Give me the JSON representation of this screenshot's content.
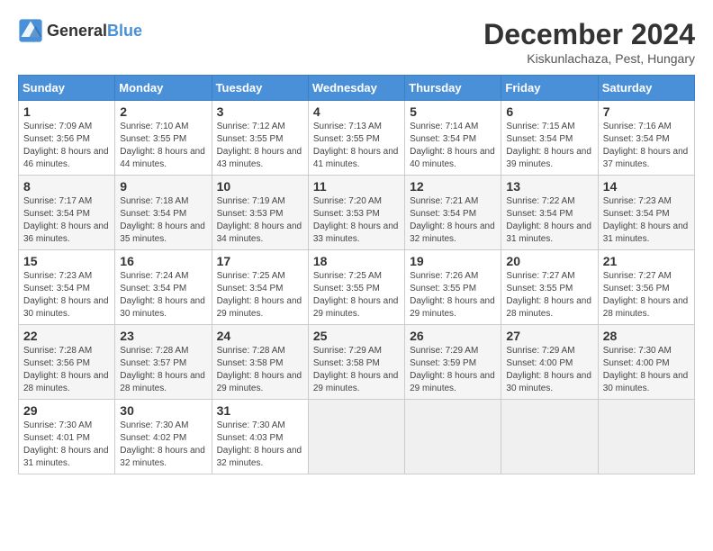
{
  "header": {
    "logo_general": "General",
    "logo_blue": "Blue",
    "title": "December 2024",
    "subtitle": "Kiskunlachaza, Pest, Hungary"
  },
  "calendar": {
    "days_of_week": [
      "Sunday",
      "Monday",
      "Tuesday",
      "Wednesday",
      "Thursday",
      "Friday",
      "Saturday"
    ],
    "weeks": [
      [
        null,
        null,
        null,
        null,
        null,
        null,
        null
      ]
    ]
  },
  "days": [
    {
      "date": "1",
      "sunrise": "7:09 AM",
      "sunset": "3:56 PM",
      "daylight": "8 hours and 46 minutes."
    },
    {
      "date": "2",
      "sunrise": "7:10 AM",
      "sunset": "3:55 PM",
      "daylight": "8 hours and 44 minutes."
    },
    {
      "date": "3",
      "sunrise": "7:12 AM",
      "sunset": "3:55 PM",
      "daylight": "8 hours and 43 minutes."
    },
    {
      "date": "4",
      "sunrise": "7:13 AM",
      "sunset": "3:55 PM",
      "daylight": "8 hours and 41 minutes."
    },
    {
      "date": "5",
      "sunrise": "7:14 AM",
      "sunset": "3:54 PM",
      "daylight": "8 hours and 40 minutes."
    },
    {
      "date": "6",
      "sunrise": "7:15 AM",
      "sunset": "3:54 PM",
      "daylight": "8 hours and 39 minutes."
    },
    {
      "date": "7",
      "sunrise": "7:16 AM",
      "sunset": "3:54 PM",
      "daylight": "8 hours and 37 minutes."
    },
    {
      "date": "8",
      "sunrise": "7:17 AM",
      "sunset": "3:54 PM",
      "daylight": "8 hours and 36 minutes."
    },
    {
      "date": "9",
      "sunrise": "7:18 AM",
      "sunset": "3:54 PM",
      "daylight": "8 hours and 35 minutes."
    },
    {
      "date": "10",
      "sunrise": "7:19 AM",
      "sunset": "3:53 PM",
      "daylight": "8 hours and 34 minutes."
    },
    {
      "date": "11",
      "sunrise": "7:20 AM",
      "sunset": "3:53 PM",
      "daylight": "8 hours and 33 minutes."
    },
    {
      "date": "12",
      "sunrise": "7:21 AM",
      "sunset": "3:54 PM",
      "daylight": "8 hours and 32 minutes."
    },
    {
      "date": "13",
      "sunrise": "7:22 AM",
      "sunset": "3:54 PM",
      "daylight": "8 hours and 31 minutes."
    },
    {
      "date": "14",
      "sunrise": "7:23 AM",
      "sunset": "3:54 PM",
      "daylight": "8 hours and 31 minutes."
    },
    {
      "date": "15",
      "sunrise": "7:23 AM",
      "sunset": "3:54 PM",
      "daylight": "8 hours and 30 minutes."
    },
    {
      "date": "16",
      "sunrise": "7:24 AM",
      "sunset": "3:54 PM",
      "daylight": "8 hours and 30 minutes."
    },
    {
      "date": "17",
      "sunrise": "7:25 AM",
      "sunset": "3:54 PM",
      "daylight": "8 hours and 29 minutes."
    },
    {
      "date": "18",
      "sunrise": "7:25 AM",
      "sunset": "3:55 PM",
      "daylight": "8 hours and 29 minutes."
    },
    {
      "date": "19",
      "sunrise": "7:26 AM",
      "sunset": "3:55 PM",
      "daylight": "8 hours and 29 minutes."
    },
    {
      "date": "20",
      "sunrise": "7:27 AM",
      "sunset": "3:55 PM",
      "daylight": "8 hours and 28 minutes."
    },
    {
      "date": "21",
      "sunrise": "7:27 AM",
      "sunset": "3:56 PM",
      "daylight": "8 hours and 28 minutes."
    },
    {
      "date": "22",
      "sunrise": "7:28 AM",
      "sunset": "3:56 PM",
      "daylight": "8 hours and 28 minutes."
    },
    {
      "date": "23",
      "sunrise": "7:28 AM",
      "sunset": "3:57 PM",
      "daylight": "8 hours and 28 minutes."
    },
    {
      "date": "24",
      "sunrise": "7:28 AM",
      "sunset": "3:58 PM",
      "daylight": "8 hours and 29 minutes."
    },
    {
      "date": "25",
      "sunrise": "7:29 AM",
      "sunset": "3:58 PM",
      "daylight": "8 hours and 29 minutes."
    },
    {
      "date": "26",
      "sunrise": "7:29 AM",
      "sunset": "3:59 PM",
      "daylight": "8 hours and 29 minutes."
    },
    {
      "date": "27",
      "sunrise": "7:29 AM",
      "sunset": "4:00 PM",
      "daylight": "8 hours and 30 minutes."
    },
    {
      "date": "28",
      "sunrise": "7:30 AM",
      "sunset": "4:00 PM",
      "daylight": "8 hours and 30 minutes."
    },
    {
      "date": "29",
      "sunrise": "7:30 AM",
      "sunset": "4:01 PM",
      "daylight": "8 hours and 31 minutes."
    },
    {
      "date": "30",
      "sunrise": "7:30 AM",
      "sunset": "4:02 PM",
      "daylight": "8 hours and 32 minutes."
    },
    {
      "date": "31",
      "sunrise": "7:30 AM",
      "sunset": "4:03 PM",
      "daylight": "8 hours and 32 minutes."
    }
  ],
  "labels": {
    "sunrise": "Sunrise:",
    "sunset": "Sunset:",
    "daylight": "Daylight:"
  }
}
